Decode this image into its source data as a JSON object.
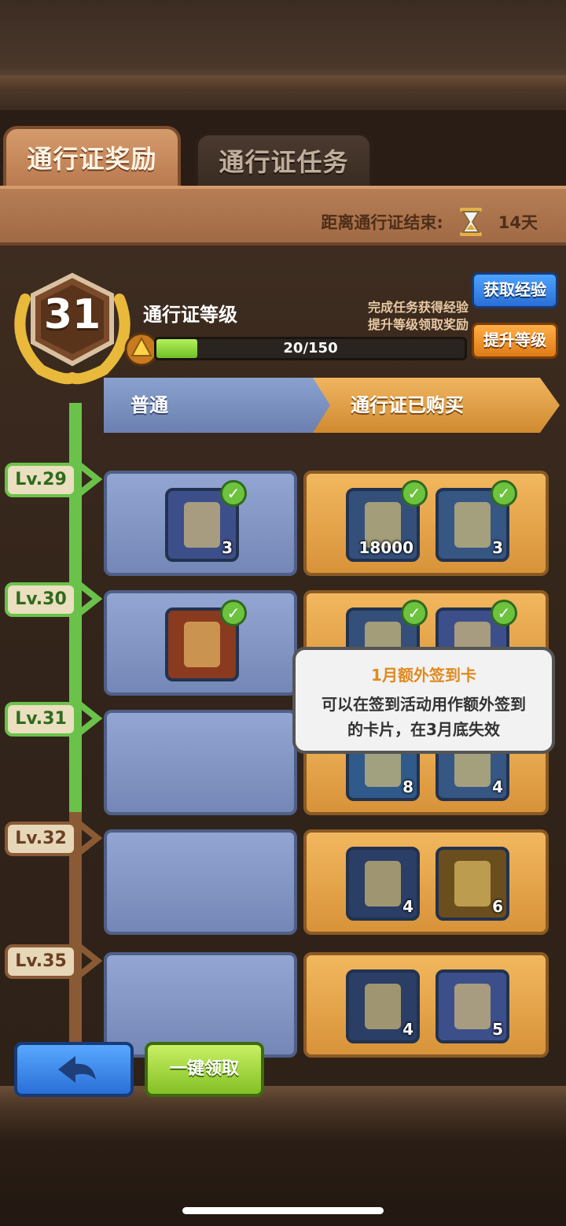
{
  "tabs": [
    {
      "label": "通行证奖励",
      "active": true
    },
    {
      "label": "通行证任务",
      "active": false
    }
  ],
  "countdown": {
    "label": "距离通行证结束:",
    "value": "14天"
  },
  "pass": {
    "level": "31",
    "title": "通行证等级",
    "hint_line1": "完成任务获得经验",
    "hint_line2": "提升等级领取奖励",
    "progress_text": "20/150",
    "progress_fraction": 0.133,
    "get_exp_label": "获取经验",
    "level_up_label": "提升等级"
  },
  "lanes": {
    "free": "普通",
    "paid": "通行证已购买"
  },
  "rows": [
    {
      "level": "Lv.29",
      "free": [
        {
          "icon": "card-pack-icon",
          "count": "3",
          "claimed": true
        }
      ],
      "paid": [
        {
          "icon": "potion-flask-icon",
          "count": "18000",
          "claimed": true
        },
        {
          "icon": "gold-scroll-icon",
          "count": "3",
          "claimed": true
        }
      ]
    },
    {
      "level": "Lv.30",
      "free": [
        {
          "icon": "hero-portrait-icon",
          "count": "",
          "claimed": true
        }
      ],
      "paid": [
        {
          "icon": "potion-flask-icon",
          "count": "",
          "claimed": true
        },
        {
          "icon": "card-pack-icon",
          "count": "",
          "claimed": true
        }
      ]
    },
    {
      "level": "Lv.31",
      "free": [],
      "paid": [
        {
          "icon": "gem-medallion-icon",
          "count": "8",
          "claimed": false
        },
        {
          "icon": "gold-scroll-icon",
          "count": "4",
          "claimed": false
        }
      ]
    },
    {
      "level": "Lv.32",
      "free": [],
      "paid": [
        {
          "icon": "rainbow-gem-icon",
          "count": "4",
          "claimed": false
        },
        {
          "icon": "gold-card-pack-icon",
          "count": "6",
          "claimed": false
        }
      ]
    },
    {
      "level": "Lv.35",
      "free": [],
      "paid": [
        {
          "icon": "rainbow-gem-icon",
          "count": "4",
          "claimed": false
        },
        {
          "icon": "card-pack-icon",
          "count": "5",
          "claimed": false
        }
      ]
    }
  ],
  "tooltip": {
    "title": "1月额外签到卡",
    "line1": "可以在签到活动用作额外签到",
    "line2": "的卡片，在3月底失效"
  },
  "buttons": {
    "back_icon": "back-arrow-icon",
    "claim_all": "一键领取"
  },
  "colors": {
    "accent_green": "#6ac24a",
    "free_lane": "#8aa1cf",
    "paid_lane": "#f0b560"
  }
}
